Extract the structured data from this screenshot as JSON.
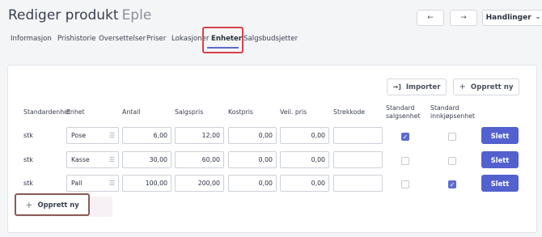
{
  "header": {
    "title": "Rediger produkt",
    "product": "Eple",
    "back": "←",
    "forward": "→",
    "actions_label": "Handlinger",
    "actions_chevron": "⌄"
  },
  "tabs": [
    "Informasjon",
    "Prishistorie",
    "Oversettelser",
    "Priser",
    "Lokasjoner",
    "Enheter",
    "Salgsbudsjetter"
  ],
  "active_tab": "Enheter",
  "toolbar": {
    "import_label": "Importer",
    "import_icon": "→]",
    "create_label": "Opprett ny",
    "create_icon": "+"
  },
  "columns": [
    "Standardenhet",
    "Enhet",
    "Antall",
    "Salgspris",
    "Kostpris",
    "Veil. pris",
    "Strekkode",
    "Standard salgsenhet",
    "Standard innkjøpsenhet"
  ],
  "rows": [
    {
      "standard_unit": "stk",
      "unit": "Pose",
      "quantity": "6,00",
      "sales_price": "12,00",
      "cost_price": "0,00",
      "suggested_price": "0,00",
      "barcode": "",
      "default_sales": true,
      "default_purchase": false,
      "delete_label": "Slett"
    },
    {
      "standard_unit": "stk",
      "unit": "Kasse",
      "quantity": "30,00",
      "sales_price": "60,00",
      "cost_price": "0,00",
      "suggested_price": "0,00",
      "barcode": "",
      "default_sales": false,
      "default_purchase": false,
      "delete_label": "Slett"
    },
    {
      "standard_unit": "stk",
      "unit": "Pall",
      "quantity": "100,00",
      "sales_price": "200,00",
      "cost_price": "0,00",
      "suggested_price": "0,00",
      "barcode": "",
      "default_sales": false,
      "default_purchase": true,
      "delete_label": "Slett"
    }
  ],
  "footer": {
    "create_label": "Opprett ny",
    "create_icon": "+"
  },
  "icons": {
    "select_icon": "list-icon",
    "check_mark": "✓"
  },
  "colors": {
    "accent": "#5361cf",
    "highlight": "#d6404b",
    "footer_highlight": "#8a5a55"
  }
}
